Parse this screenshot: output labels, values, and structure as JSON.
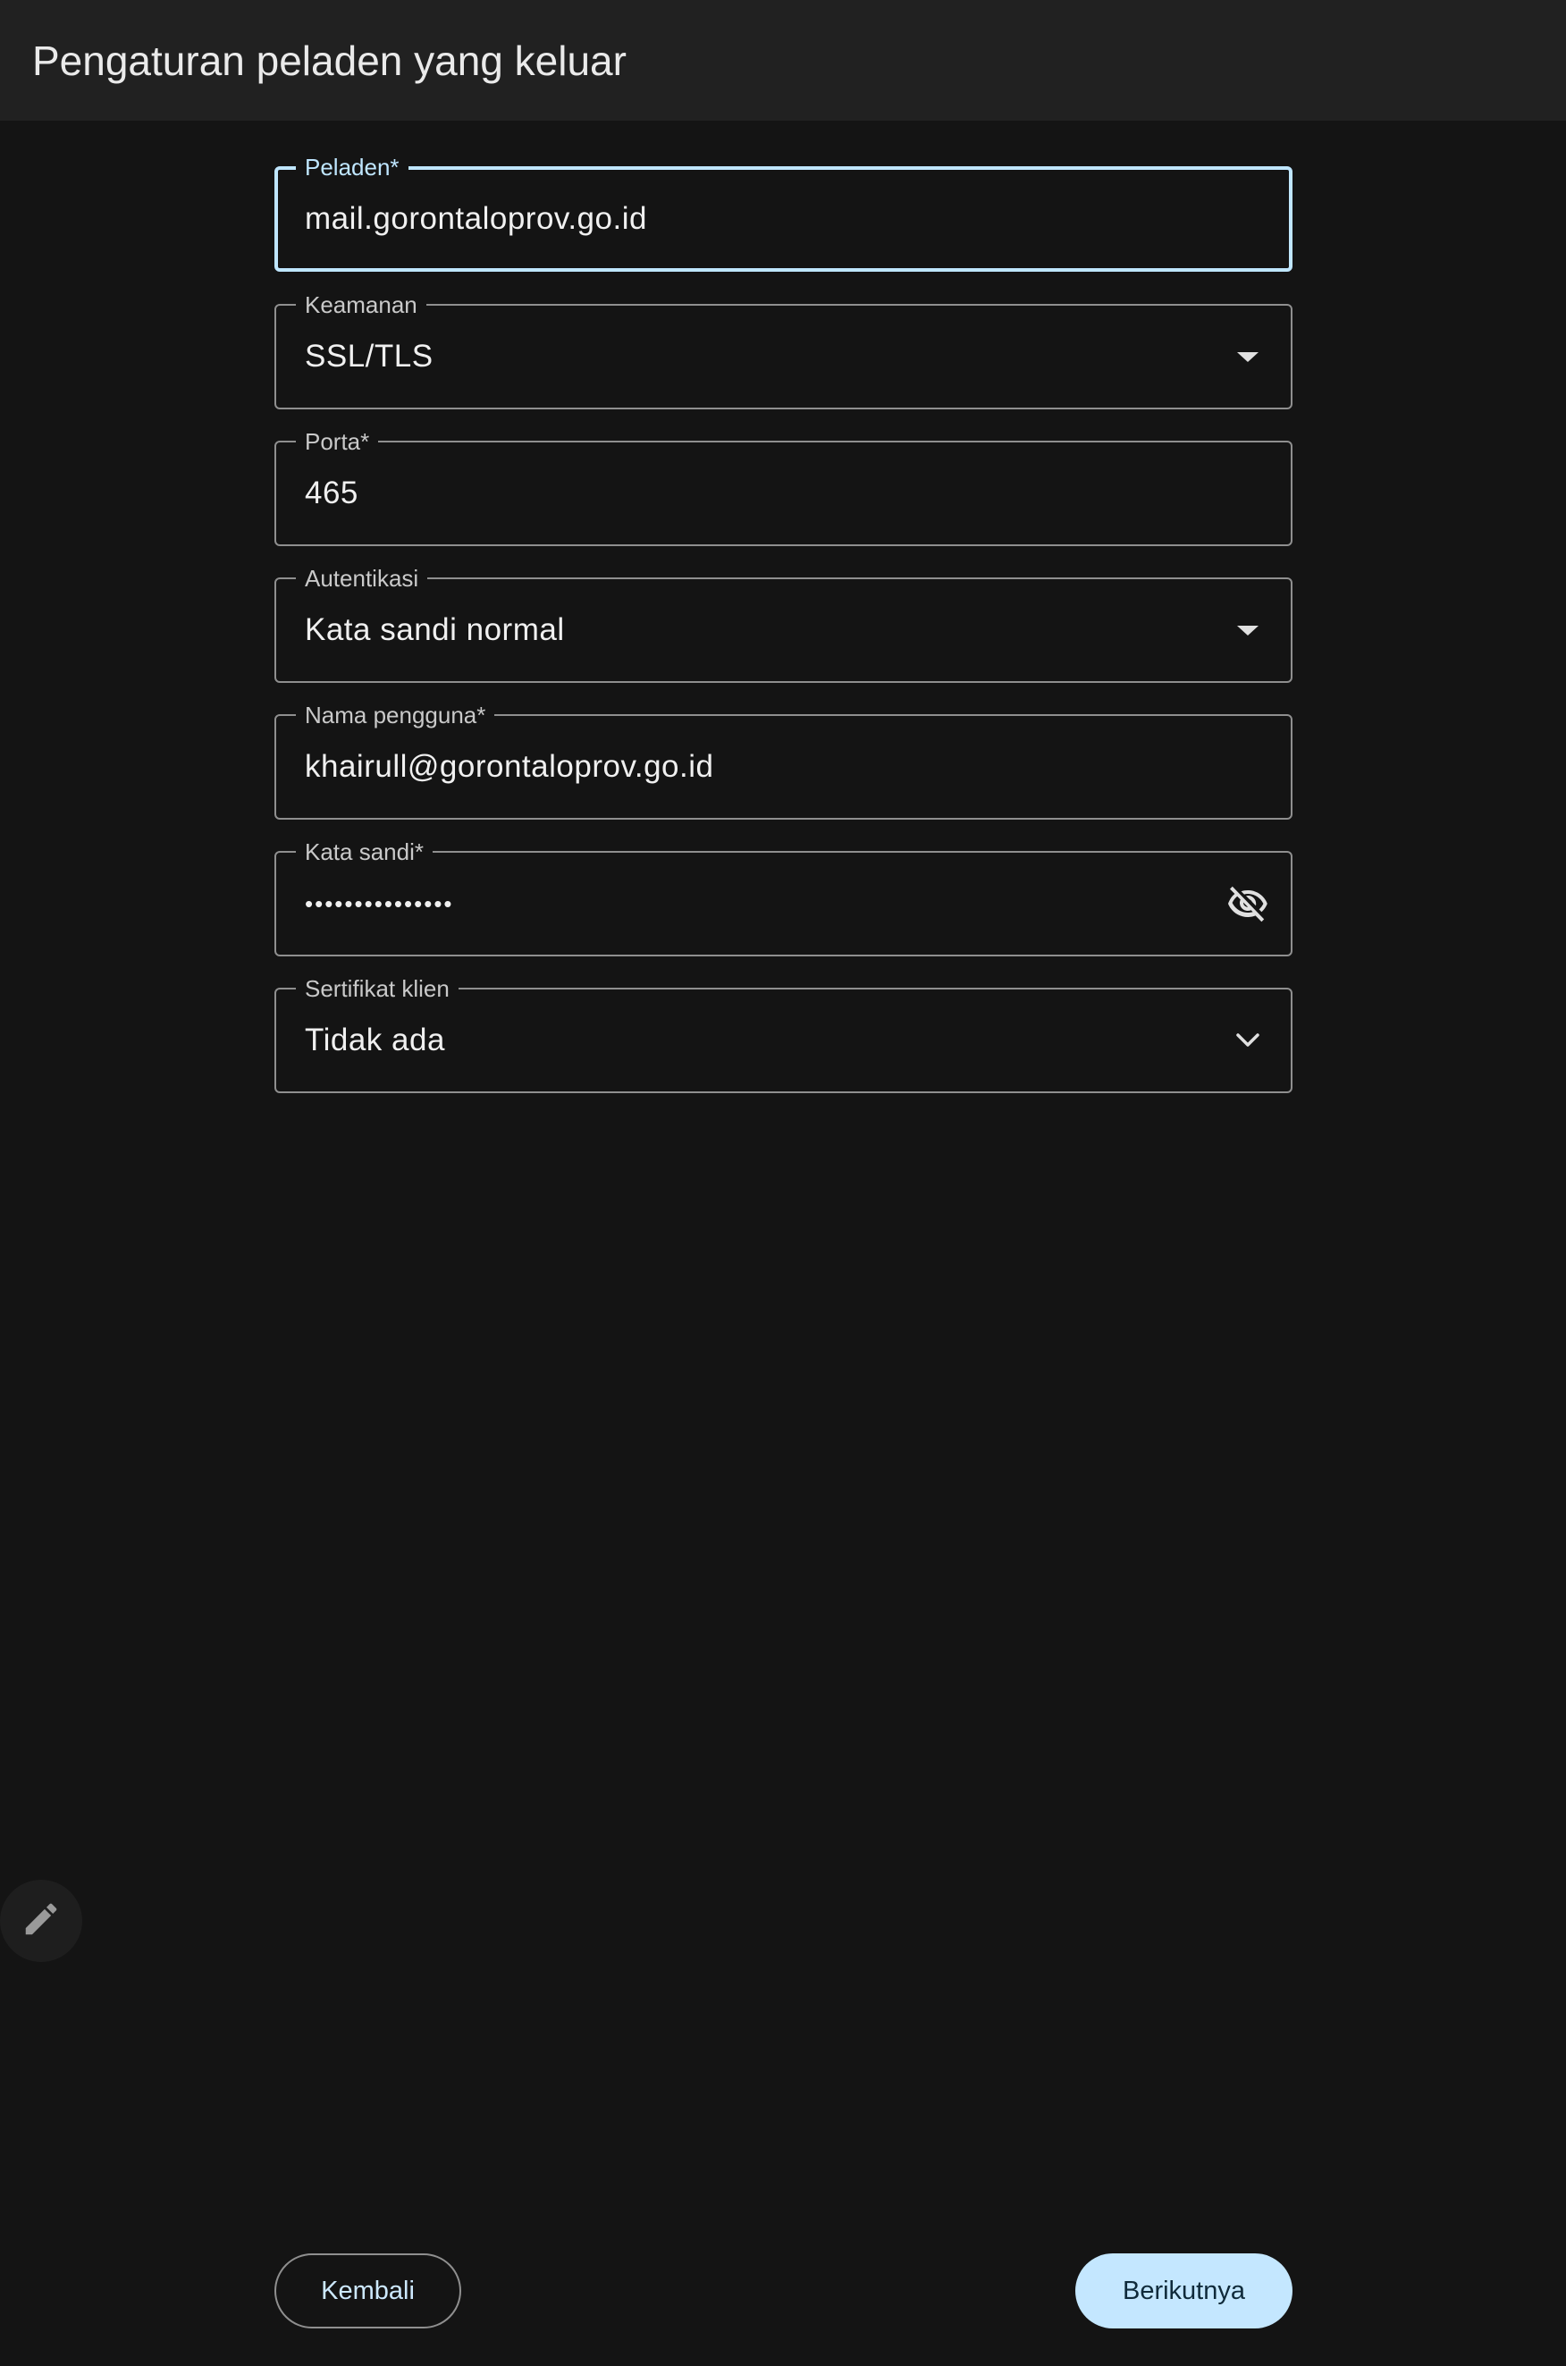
{
  "header": {
    "title": "Pengaturan peladen yang keluar"
  },
  "form": {
    "server": {
      "label": "Peladen*",
      "value": "mail.gorontaloprov.go.id"
    },
    "security": {
      "label": "Keamanan",
      "value": "SSL/TLS"
    },
    "port": {
      "label": "Porta*",
      "value": "465"
    },
    "authentication": {
      "label": "Autentikasi",
      "value": "Kata sandi normal"
    },
    "username": {
      "label": "Nama pengguna*",
      "value": "khairull@gorontaloprov.go.id"
    },
    "password": {
      "label": "Kata sandi*",
      "value": "•••••••••••••••"
    },
    "client_certificate": {
      "label": "Sertifikat klien",
      "value": "Tidak ada"
    }
  },
  "icons": {
    "dropdown": "arrow-drop-down-icon",
    "password_toggle": "visibility-off-icon",
    "expand": "chevron-down-icon",
    "edit": "pencil-icon"
  },
  "buttons": {
    "back_label": "Kembali",
    "next_label": "Berikutnya"
  },
  "colors": {
    "background": "#141414",
    "topbar": "#212121",
    "accent": "#c4e7ff",
    "focus_border": "#bfe6ff"
  }
}
